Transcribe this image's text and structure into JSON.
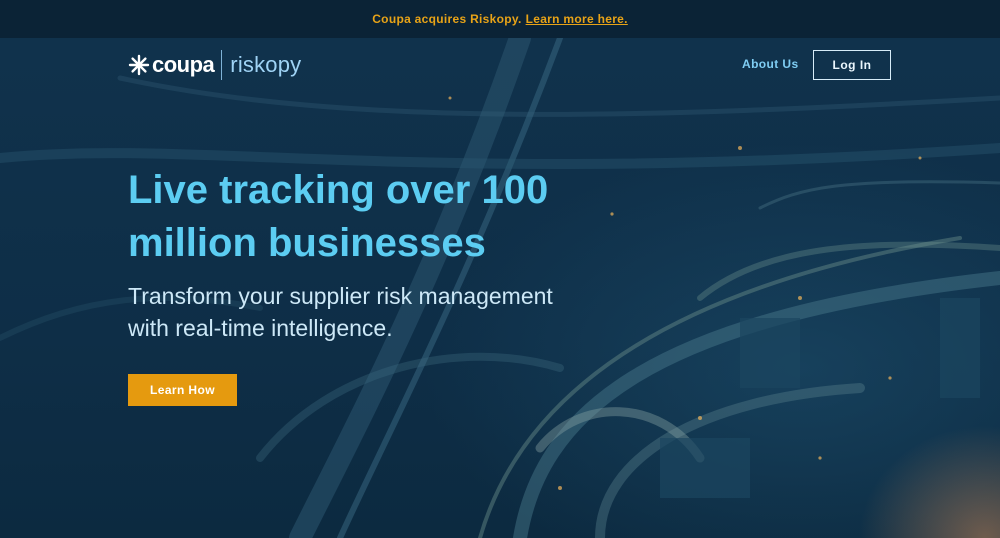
{
  "announcement": {
    "text": "Coupa acquires Riskopy.",
    "link": "Learn more here."
  },
  "nav": {
    "logo_primary": "coupa",
    "logo_secondary": "riskopy",
    "about": "About Us",
    "login": "Log In"
  },
  "hero": {
    "headline": "Live tracking over 100 million businesses",
    "subhead": "Transform your supplier risk management with real-time intelligence.",
    "cta": "Learn How"
  },
  "colors": {
    "accent": "#e59a0f",
    "headline": "#5ccdf2",
    "background": "#0d2a42"
  },
  "icons": {
    "logo_mark": "coupa-star-icon"
  }
}
